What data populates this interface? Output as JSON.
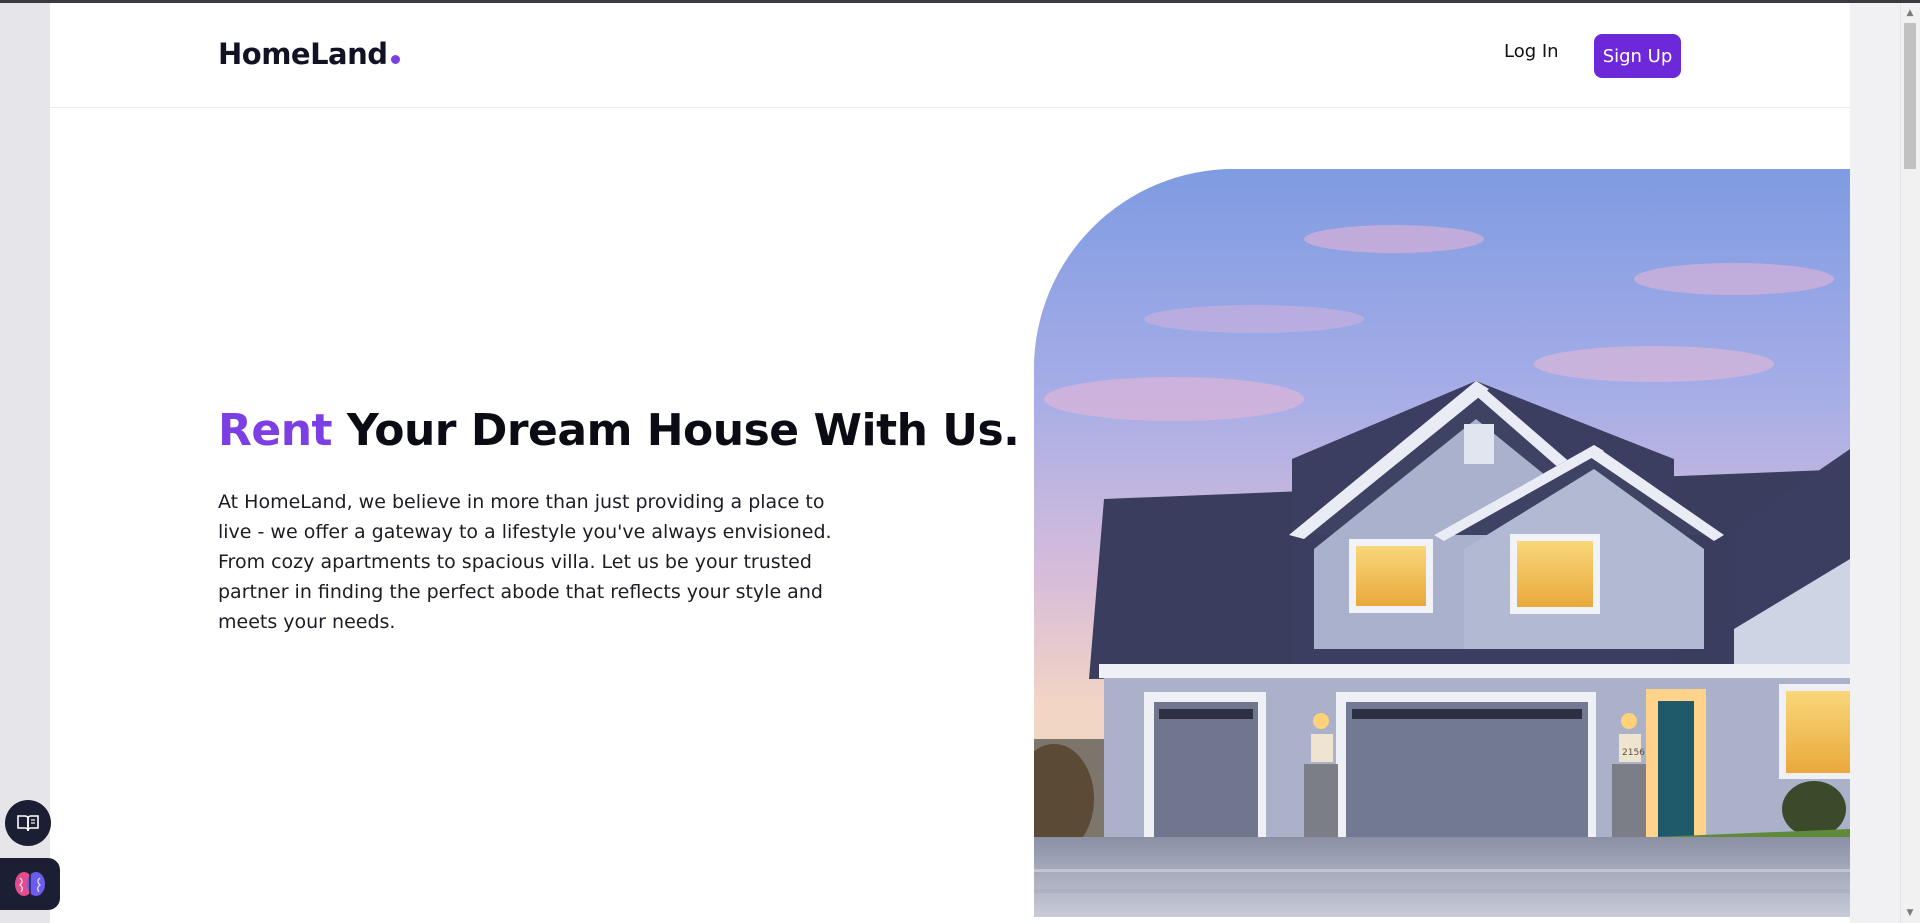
{
  "brand": {
    "name": "HomeLand",
    "accent": "#7b3fe4"
  },
  "nav": {
    "login_label": "Log In",
    "signup_label": "Sign Up",
    "signup_color": "#6d28d9"
  },
  "hero": {
    "title_accent": "Rent",
    "title_rest": "Your Dream House With Us.",
    "description": "At HomeLand, we believe in more than just providing a place to live - we offer a gateway to a lifestyle you've always envisioned. From cozy apartments to spacious villa. Let us be your trusted partner in finding the perfect abode that reflects your style and meets your needs.",
    "image_alt": "house-image",
    "house_number": "2156"
  },
  "icons": {
    "book": "open-book-icon",
    "brain": "brain-icon"
  }
}
